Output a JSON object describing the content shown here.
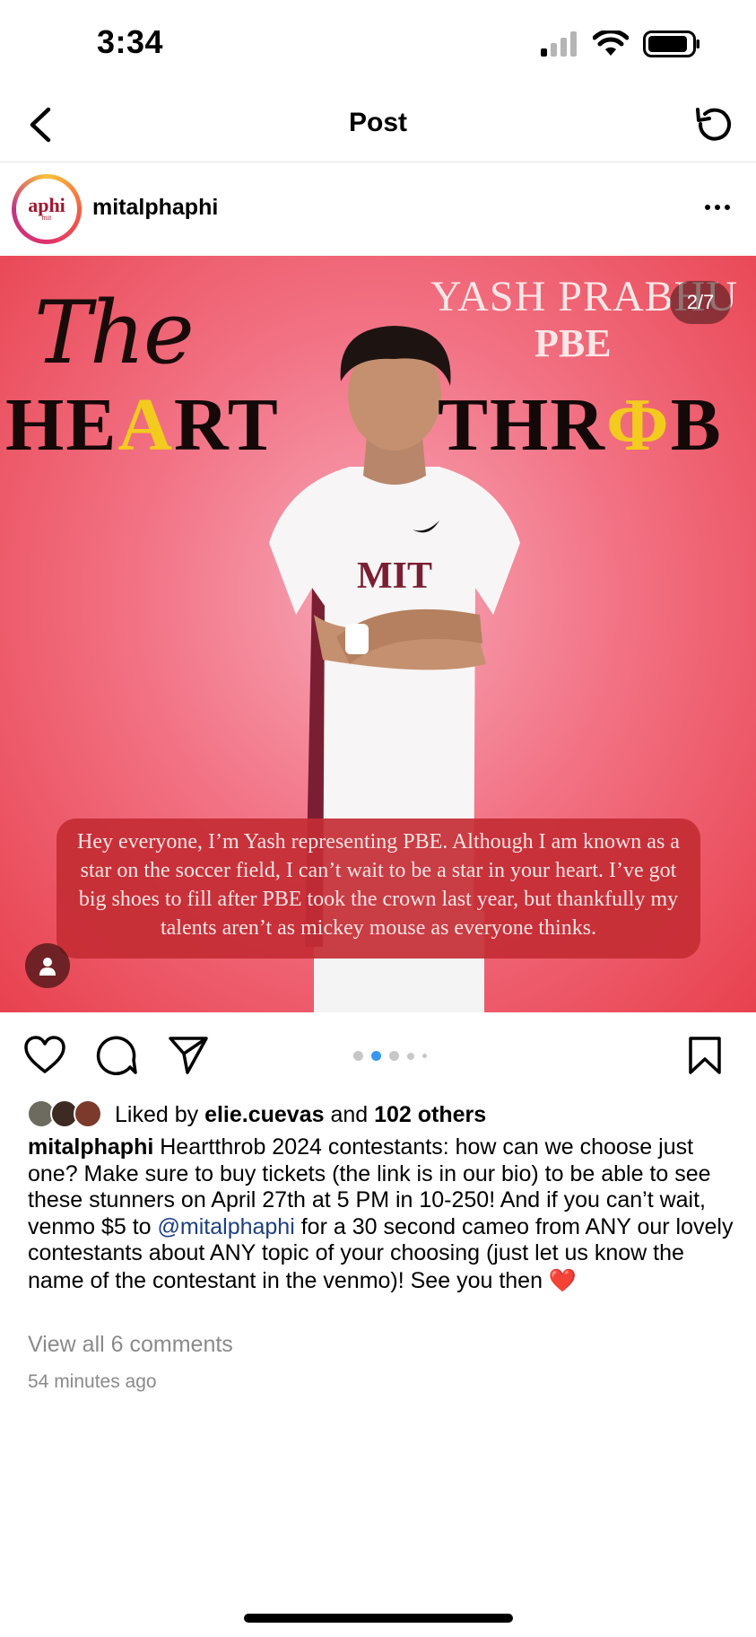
{
  "status_bar": {
    "time": "3:34"
  },
  "nav": {
    "title": "Post"
  },
  "post": {
    "username": "mitalphaphi",
    "avatar_logo": "aphi",
    "avatar_sub": "mit",
    "image": {
      "slide_counter": "2/7",
      "script_word": "The",
      "heart_word": {
        "pre": "HE",
        "gold": "A",
        "post": "RT"
      },
      "throb_word": {
        "pre": "THR",
        "gold": "Φ",
        "post": "B"
      },
      "contestant_name": "YASH PRABHU",
      "chapter": "PBE",
      "caption_text": "Hey everyone, I’m Yash representing PBE. Although I am known as a star on the soccer field, I can’t wait to be a star in your heart. I’ve got big shoes to fill after PBE took the crown last year, but thankfully my talents aren’t as mickey mouse as everyone thinks.",
      "jersey_text": "MIT"
    },
    "carousel": {
      "total_dots": 5,
      "active_index": 1
    },
    "likes": {
      "prefix": "Liked by ",
      "user": "elie.cuevas",
      "middle": " and ",
      "others": "102 others"
    },
    "caption": {
      "username": "mitalphaphi",
      "text_before": " Heartthrob 2024 contestants: how can we choose just one? Make sure to buy tickets (the link is in our bio) to be able to see these stunners on April 27th at 5 PM in 10-250! And if you can’t wait, venmo $5 to ",
      "mention": "@mitalphaphi",
      "text_after": " for a 30 second cameo from ANY our lovely contestants about ANY topic of your choosing (just let us know the name of the contestant in the venmo)! See you then ",
      "emoji": "❤️"
    },
    "view_comments": "View all 6 comments",
    "timestamp": "54 minutes ago"
  },
  "colors": {
    "image_red": "#e8414e",
    "gold": "#f3cb1e",
    "mention": "#1c3f80",
    "muted": "#8a8a8a"
  },
  "icons": [
    "back-arrow-icon",
    "refresh-icon",
    "more-icon",
    "like-heart-icon",
    "comment-icon",
    "share-icon",
    "bookmark-icon",
    "tag-user-icon",
    "signal-icon",
    "wifi-icon",
    "battery-icon"
  ]
}
